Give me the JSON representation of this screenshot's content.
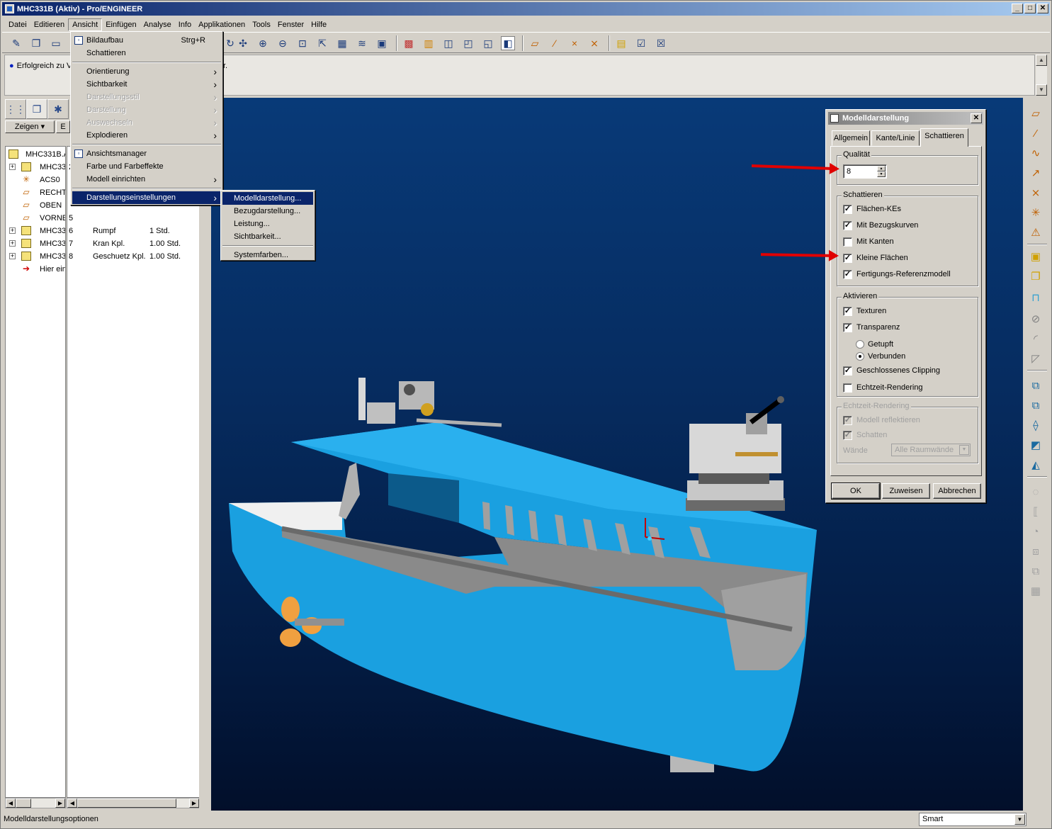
{
  "window": {
    "title": "MHC331B (Aktiv) - Pro/ENGINEER",
    "buttons": [
      "_",
      "□",
      "✕"
    ]
  },
  "menubar": [
    {
      "label": "Datei",
      "open": false
    },
    {
      "label": "Editieren",
      "open": false
    },
    {
      "label": "Ansicht",
      "open": true
    },
    {
      "label": "Einfügen",
      "open": false
    },
    {
      "label": "Analyse",
      "open": false
    },
    {
      "label": "Info",
      "open": false
    },
    {
      "label": "Applikationen",
      "open": false
    },
    {
      "label": "Tools",
      "open": false
    },
    {
      "label": "Fenster",
      "open": false
    },
    {
      "label": "Hilfe",
      "open": false
    }
  ],
  "message": {
    "text": "Erfolgreich zu V",
    "suffix": "r."
  },
  "left_panel": {
    "zeigen_label": "Zeigen ▾",
    "second_button": "E",
    "tree_rows": [
      {
        "label": "MHC331B.A",
        "num": "",
        "name": "",
        "qty": "",
        "icon": "asm",
        "expand": false
      },
      {
        "label": "MHC33",
        "num": "2",
        "name": "",
        "qty": "",
        "icon": "asm",
        "expand": true
      },
      {
        "label": "ACS0",
        "num": "",
        "name": "",
        "qty": "",
        "icon": "csys",
        "expand": false
      },
      {
        "label": "RECHT",
        "num": "",
        "name": "",
        "qty": "",
        "icon": "plane",
        "expand": false
      },
      {
        "label": "OBEN",
        "num": "",
        "name": "",
        "qty": "",
        "icon": "plane",
        "expand": false
      },
      {
        "label": "VORNE",
        "num": "5",
        "name": "",
        "qty": "",
        "icon": "plane",
        "expand": false
      },
      {
        "label": "MHC33",
        "num": "6",
        "name": "Rumpf",
        "qty": "1 Std.",
        "icon": "part",
        "expand": true
      },
      {
        "label": "MHC33",
        "num": "7",
        "name": "Kran Kpl.",
        "qty": "1.00 Std.",
        "icon": "part",
        "expand": true
      },
      {
        "label": "MHC33",
        "num": "8",
        "name": "Geschuetz Kpl.",
        "qty": "1.00 Std.",
        "icon": "part",
        "expand": true
      },
      {
        "label": "Hier ein",
        "num": "",
        "name": "",
        "qty": "",
        "icon": "insert",
        "expand": false
      }
    ]
  },
  "ansicht_menu": {
    "items": [
      {
        "label": "Bildaufbau",
        "shortcut": "Strg+R",
        "submenu": false,
        "disabled": false,
        "highlight": false,
        "icon": true
      },
      {
        "label": "Schattieren",
        "shortcut": "",
        "submenu": false,
        "disabled": false,
        "highlight": false,
        "icon": false
      },
      {
        "sep": true
      },
      {
        "label": "Orientierung",
        "shortcut": "",
        "submenu": true,
        "disabled": false,
        "highlight": false,
        "icon": false
      },
      {
        "label": "Sichtbarkeit",
        "shortcut": "",
        "submenu": true,
        "disabled": false,
        "highlight": false,
        "icon": false
      },
      {
        "label": "Darstellungsstil",
        "shortcut": "",
        "submenu": true,
        "disabled": true,
        "highlight": false,
        "icon": false
      },
      {
        "label": "Darstellung",
        "shortcut": "",
        "submenu": true,
        "disabled": true,
        "highlight": false,
        "icon": false
      },
      {
        "label": "Auswechseln",
        "shortcut": "",
        "submenu": true,
        "disabled": true,
        "highlight": false,
        "icon": false
      },
      {
        "label": "Explodieren",
        "shortcut": "",
        "submenu": true,
        "disabled": false,
        "highlight": false,
        "icon": false
      },
      {
        "sep": true
      },
      {
        "label": "Ansichtsmanager",
        "shortcut": "",
        "submenu": false,
        "disabled": false,
        "highlight": false,
        "icon": true
      },
      {
        "label": "Farbe und Farbeffekte",
        "shortcut": "",
        "submenu": false,
        "disabled": false,
        "highlight": false,
        "icon": false
      },
      {
        "label": "Modell einrichten",
        "shortcut": "",
        "submenu": true,
        "disabled": false,
        "highlight": false,
        "icon": false
      },
      {
        "sep": true
      },
      {
        "label": "Darstellungseinstellungen",
        "shortcut": "",
        "submenu": true,
        "disabled": false,
        "highlight": true,
        "icon": false
      }
    ]
  },
  "darstellung_submenu": {
    "items": [
      {
        "label": "Modelldarstellung...",
        "highlight": true
      },
      {
        "label": "Bezugdarstellung...",
        "highlight": false
      },
      {
        "label": "Leistung...",
        "highlight": false
      },
      {
        "label": "Sichtbarkeit...",
        "highlight": false
      },
      {
        "sep": true
      },
      {
        "label": "Systemfarben...",
        "highlight": false
      }
    ]
  },
  "dialog": {
    "title": "Modelldarstellung",
    "tabs": [
      "Allgemein",
      "Kante/Linie",
      "Schattieren"
    ],
    "active_tab": "Schattieren",
    "quality_label": "Qualität",
    "quality_value": "8",
    "schattieren_label": "Schattieren",
    "schattieren_options": [
      {
        "label": "Flächen-KEs",
        "checked": true
      },
      {
        "label": "Mit Bezugskurven",
        "checked": true
      },
      {
        "label": "Mit Kanten",
        "checked": false
      },
      {
        "label": "Kleine Flächen",
        "checked": true
      },
      {
        "label": "Fertigungs-Referenzmodell",
        "checked": true
      }
    ],
    "aktivieren_label": "Aktivieren",
    "texturen": {
      "label": "Texturen",
      "checked": true
    },
    "transparenz": {
      "label": "Transparenz",
      "checked": true
    },
    "radio_options": [
      {
        "label": "Getupft",
        "selected": false
      },
      {
        "label": "Verbunden",
        "selected": true
      }
    ],
    "clipping": {
      "label": "Geschlossenes Clipping",
      "checked": true
    },
    "echtzeit": {
      "label": "Echtzeit-Rendering",
      "checked": false
    },
    "echtzeit_group_label": "Echtzeit-Rendering",
    "echtzeit_options": [
      {
        "label": "Modell reflektieren",
        "checked": true
      },
      {
        "label": "Schatten",
        "checked": true
      }
    ],
    "waende_label": "Wände",
    "waende_value": "Alle Raumwände",
    "buttons": [
      "OK",
      "Zuweisen",
      "Abbrechen"
    ]
  },
  "statusbar": {
    "text": "Modelldarstellungsoptionen",
    "filter_value": "Smart"
  },
  "colors": {
    "title_bar": "#0a246a",
    "menu_highlight": "#0a246a",
    "viewport_background": "#062c60",
    "hull": "#1aa0e0",
    "annotation_arrow": "#e00000",
    "propeller": "#f0a040"
  }
}
